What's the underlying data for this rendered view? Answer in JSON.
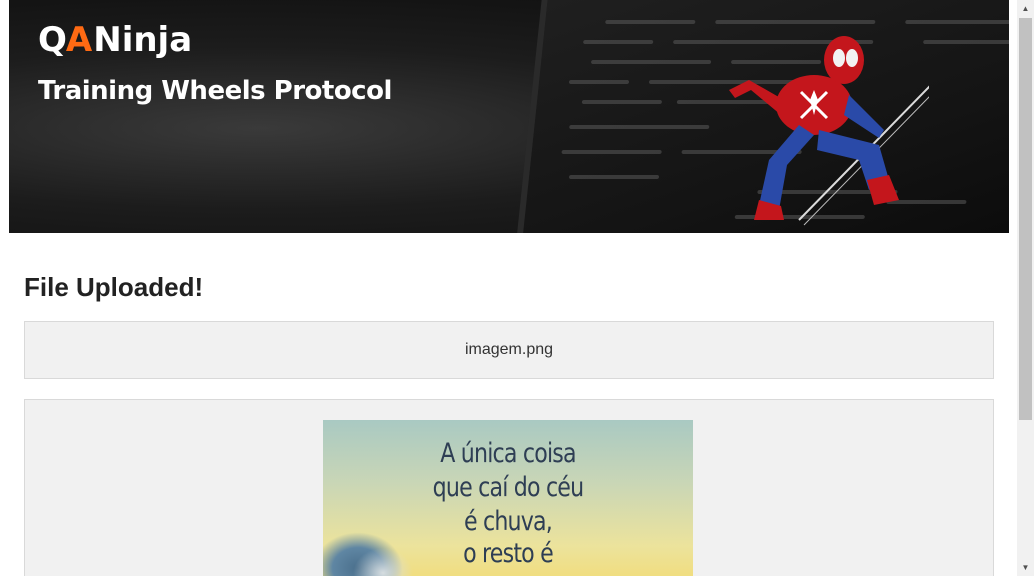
{
  "header": {
    "logo": {
      "prefix": "QA",
      "highlight_letter": "A",
      "name": "Ninja"
    },
    "tagline": "Training Wheels Protocol",
    "hero_image": "spider-man-illustration"
  },
  "main": {
    "title": "File Uploaded!",
    "filename": "imagem.png",
    "preview": {
      "quote_lines": [
        "A única coisa",
        "que caí do céu",
        "é chuva,",
        "o resto é"
      ]
    }
  },
  "colors": {
    "accent": "#ff6a13",
    "banner_bg": "#111111",
    "panel_bg": "#f1f1f1"
  },
  "scrollbar": {
    "up_icon": "chevron-up-icon",
    "down_icon": "chevron-down-icon"
  }
}
